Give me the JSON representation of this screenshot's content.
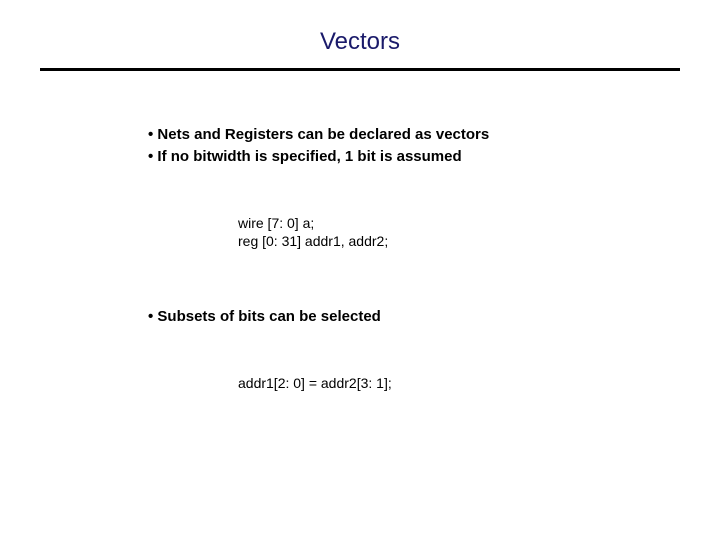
{
  "slide": {
    "title": "Vectors",
    "bullets": {
      "b1": "• Nets and Registers can be declared as vectors",
      "b2": "• If no bitwidth is specified, 1 bit is assumed",
      "b3": "• Subsets of bits can be selected"
    },
    "code": {
      "line1": "wire [7: 0] a;",
      "line2": "reg [0: 31] addr1, addr2;",
      "line3": "addr1[2: 0] = addr2[3: 1];"
    }
  }
}
